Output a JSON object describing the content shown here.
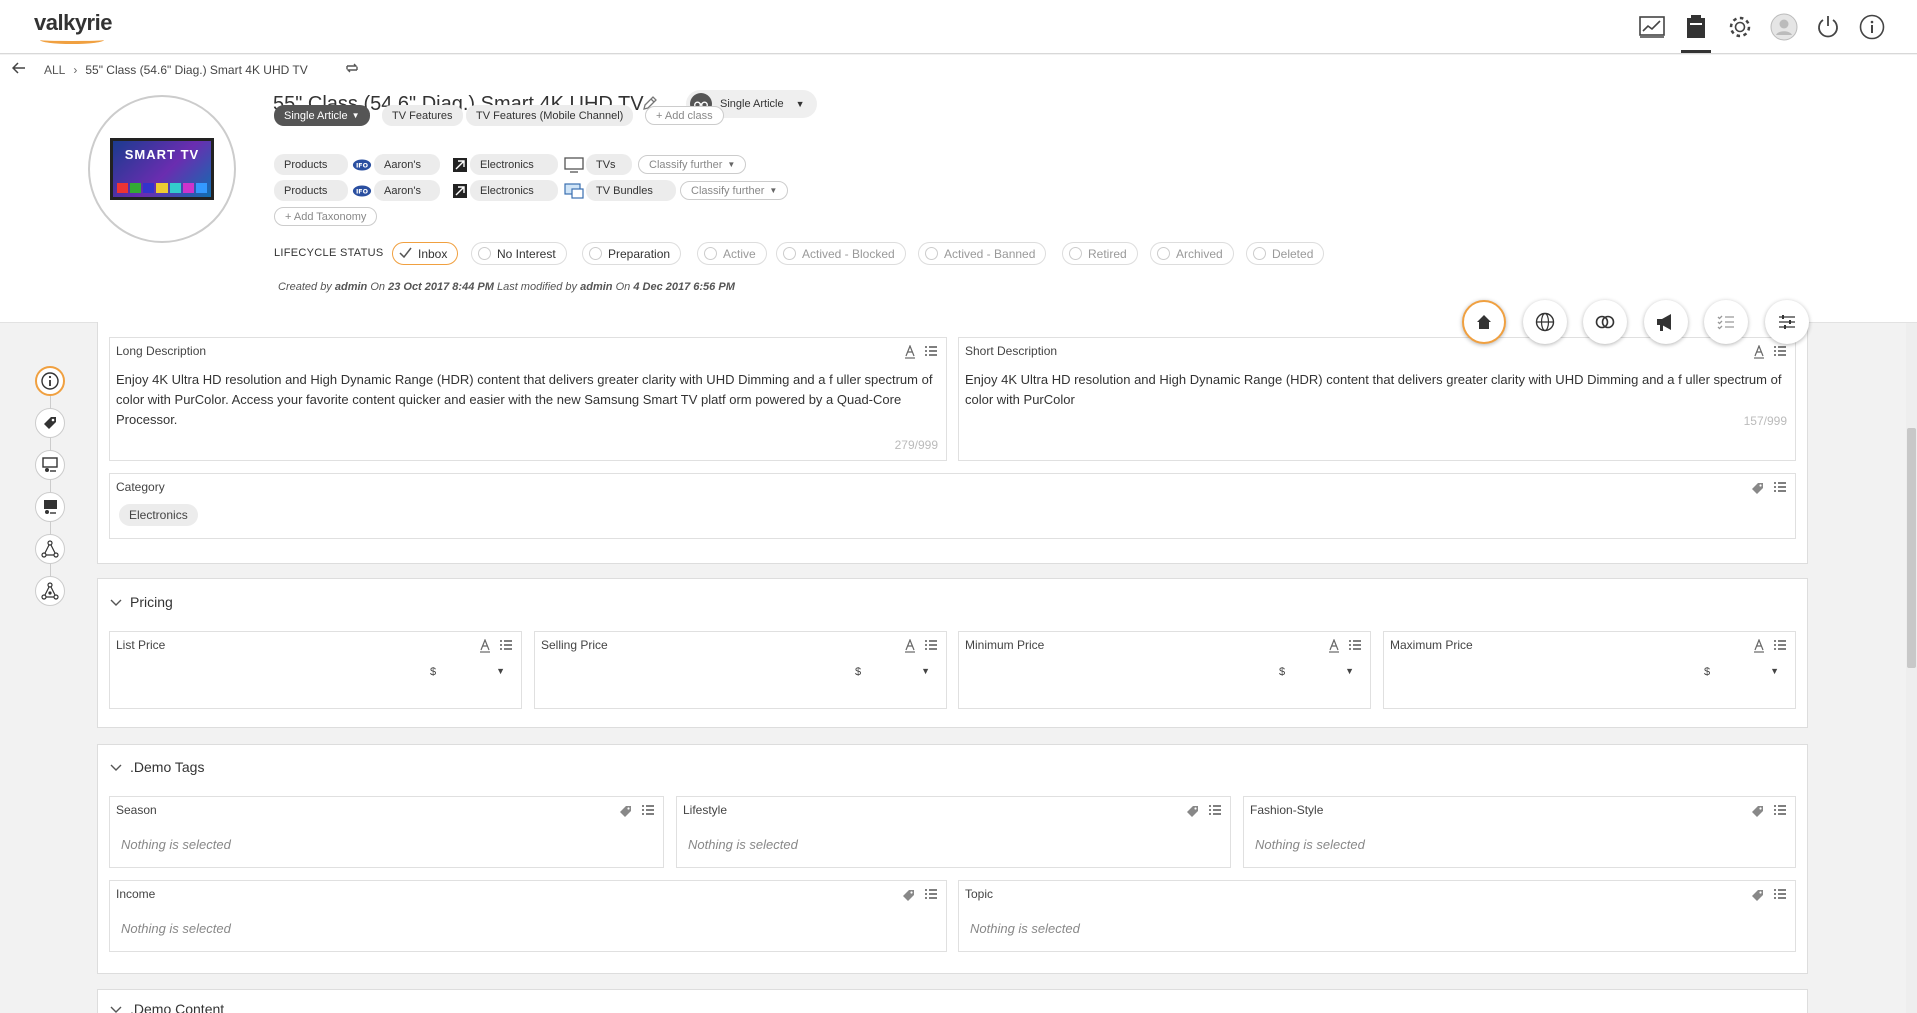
{
  "app": {
    "logo": "valkyrie"
  },
  "nav": {
    "icons": [
      "dashboard-icon",
      "catalog-icon",
      "settings-icon",
      "user-icon",
      "power-icon",
      "info-icon"
    ],
    "active": "catalog-icon"
  },
  "breadcrumb": {
    "all": "ALL",
    "current": "55\" Class (54.6\" Diag.) Smart 4K UHD TV"
  },
  "product": {
    "image_text": "SMART TV",
    "title": "55\" Class (54.6\" Diag.) Smart 4K UHD TV",
    "type": "Single Article"
  },
  "classes": {
    "primary": "Single Article",
    "items": [
      "TV Features",
      "TV Features (Mobile Channel)"
    ],
    "add_label": "+ Add class"
  },
  "taxonomy": {
    "rows": [
      {
        "root": "Products",
        "brand": "Aaron's",
        "category": "Electronics",
        "leaf": "TVs",
        "classify": "Classify further"
      },
      {
        "root": "Products",
        "brand": "Aaron's",
        "category": "Electronics",
        "leaf": "TV Bundles",
        "classify": "Classify further"
      }
    ],
    "add_label": "+ Add Taxonomy"
  },
  "lifecycle": {
    "label": "LIFECYCLE STATUS",
    "statuses": [
      "Inbox",
      "No Interest",
      "Preparation",
      "Active",
      "Actived - Blocked",
      "Actived - Banned",
      "Retired",
      "Archived",
      "Deleted"
    ],
    "selected": "Inbox"
  },
  "meta": {
    "created_by_label": "Created by",
    "created_by": "admin",
    "created_on_label": "On",
    "created_on": "23 Oct 2017 8:44 PM",
    "modified_label": "Last modified by",
    "modified_by": "admin",
    "modified_on_label": "On",
    "modified_on": "4 Dec 2017 6:56 PM"
  },
  "description": {
    "long_label": "Long Description",
    "long_text": "Enjoy 4K Ultra HD resolution and High Dynamic Range (HDR) content that delivers greater clarity with UHD Dimming and a f uller spectrum of color with PurColor. Access your favorite content quicker and easier with the new Samsung Smart TV platf orm powered by a Quad-Core Processor.",
    "long_count": "279/999",
    "short_label": "Short Description",
    "short_text": "Enjoy 4K Ultra HD resolution and High Dynamic Range (HDR) content that delivers greater clarity with UHD Dimming and a f uller spectrum of color with PurColor",
    "short_count": "157/999",
    "category_label": "Category",
    "category_value": "Electronics"
  },
  "pricing": {
    "title": "Pricing",
    "fields": [
      {
        "label": "List Price",
        "currency": "$"
      },
      {
        "label": "Selling Price",
        "currency": "$"
      },
      {
        "label": "Minimum Price",
        "currency": "$"
      },
      {
        "label": "Maximum Price",
        "currency": "$"
      }
    ]
  },
  "demo_tags": {
    "title": ".Demo Tags",
    "fields": [
      {
        "label": "Season",
        "value": "Nothing is selected"
      },
      {
        "label": "Lifestyle",
        "value": "Nothing is selected"
      },
      {
        "label": "Fashion-Style",
        "value": "Nothing is selected"
      },
      {
        "label": "Income",
        "value": "Nothing is selected"
      },
      {
        "label": "Topic",
        "value": "Nothing is selected"
      }
    ]
  },
  "demo_content": {
    "title": ".Demo Content"
  },
  "colors": {
    "accent": "#f0a040",
    "dark_chip": "#555555"
  }
}
